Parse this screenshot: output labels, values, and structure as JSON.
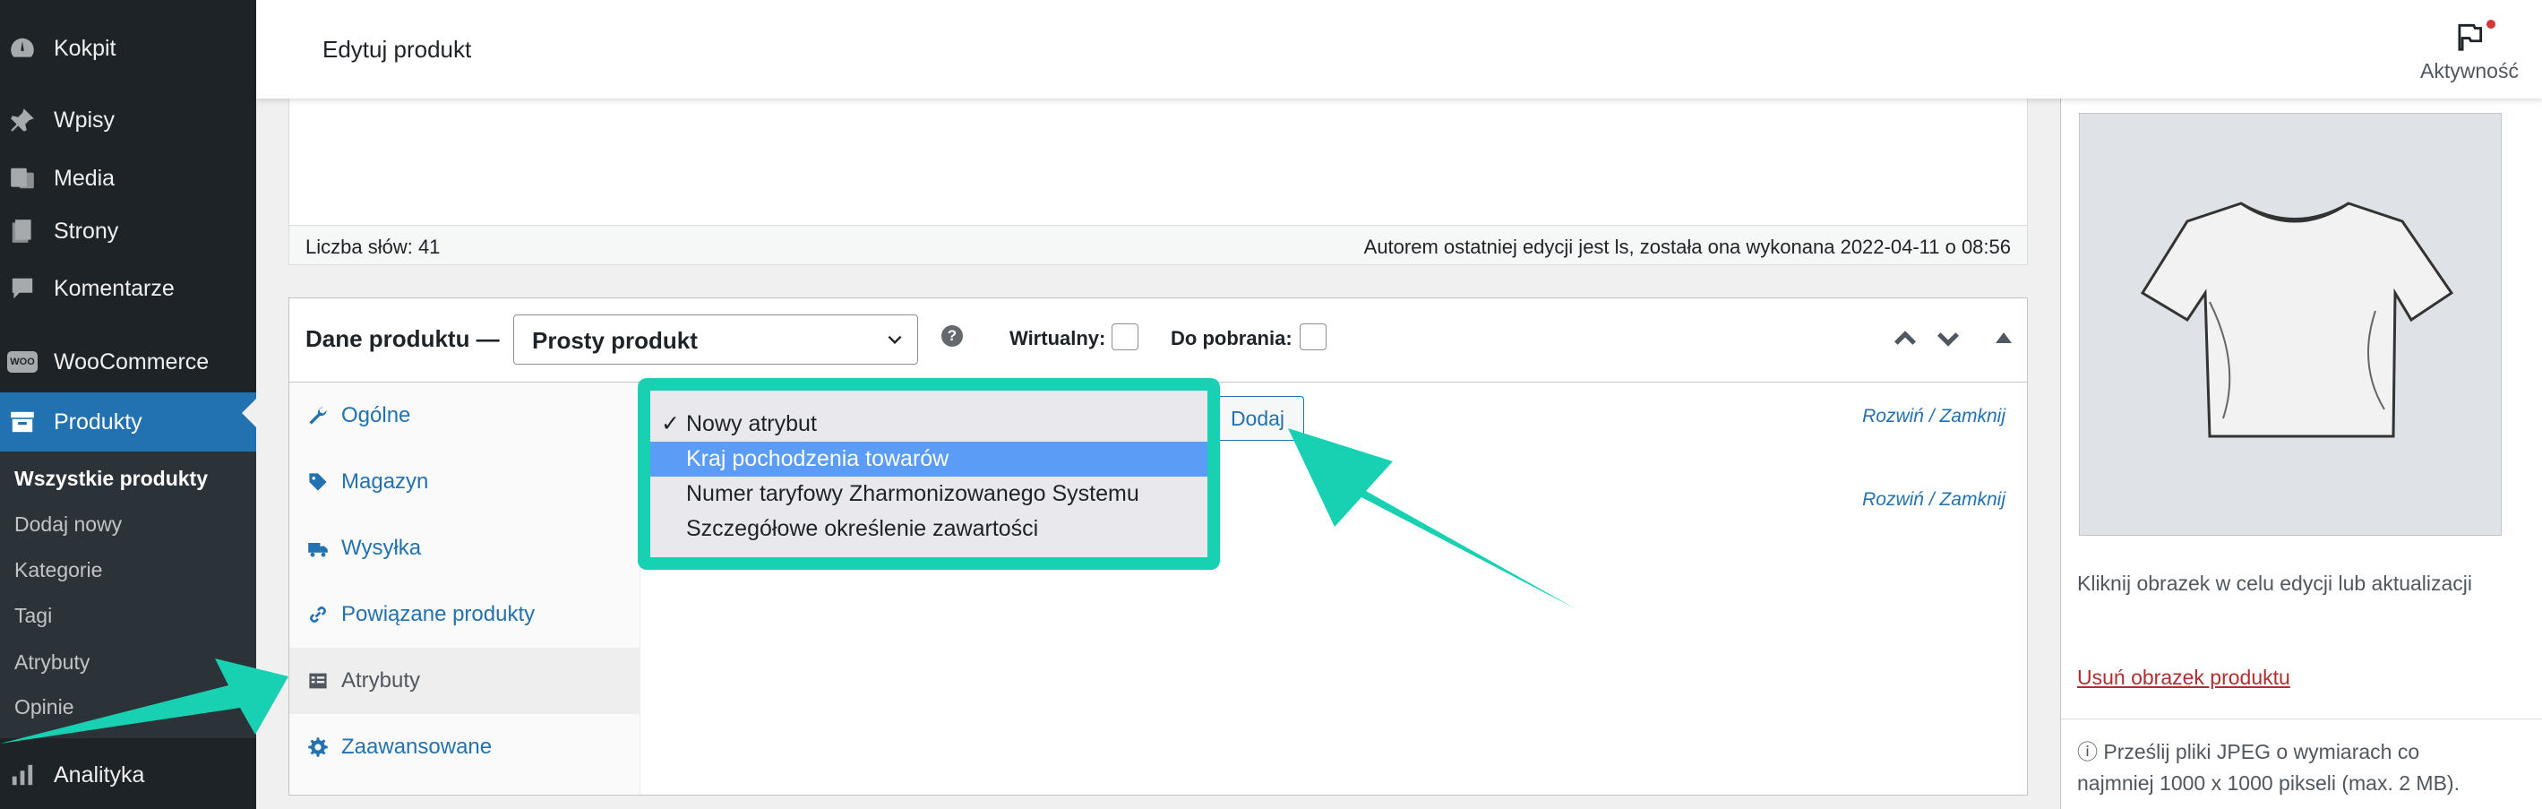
{
  "sidebar": {
    "items": [
      {
        "label": "Kokpit",
        "icon": "dashboard-icon"
      },
      {
        "label": "Wpisy",
        "icon": "pin-icon"
      },
      {
        "label": "Media",
        "icon": "media-icon"
      },
      {
        "label": "Strony",
        "icon": "pages-icon"
      },
      {
        "label": "Komentarze",
        "icon": "comments-icon"
      },
      {
        "label": "WooCommerce",
        "icon": "woocommerce-icon"
      },
      {
        "label": "Produkty",
        "icon": "archive-icon"
      },
      {
        "label": "Analityka",
        "icon": "chart-bar-icon"
      }
    ],
    "submenu": [
      "Wszystkie produkty",
      "Dodaj nowy",
      "Kategorie",
      "Tagi",
      "Atrybuty",
      "Opinie"
    ],
    "woo_badge": "WOO"
  },
  "topbar": {
    "title": "Edytuj produkt",
    "activity_label": "Aktywność"
  },
  "editor": {
    "word_count": "Liczba słów: 41",
    "last_edit": "Autorem ostatniej edycji jest ls, została ona wykonana 2022-04-11 o 08:56"
  },
  "product_data": {
    "title": "Dane produktu —",
    "type_selected": "Prosty produkt",
    "help": "?",
    "virtual_label": "Wirtualny:",
    "download_label": "Do pobrania:",
    "tabs": [
      "Ogólne",
      "Magazyn",
      "Wysyłka",
      "Powiązane produkty",
      "Atrybuty",
      "Zaawansowane"
    ],
    "add_button": "Dodaj",
    "expand_collapse": "Rozwiń / Zamknij"
  },
  "attribute_menu": {
    "check": "✓",
    "options": [
      "Nowy atrybut",
      "Kraj pochodzenia towarów",
      "Numer taryfowy Zharmonizowanego Systemu",
      "Szczegółowe określenie zawartości"
    ]
  },
  "image_box": {
    "hint": "Kliknij obrazek w celu edycji lub aktualizacji",
    "remove_link": "Usuń obrazek produktu",
    "info": "ⓘ Prześlij pliki JPEG o wymiarach co najmniej 1000 x 1000 pikseli (max. 2 MB)."
  },
  "colors": {
    "sidebar_bg": "#1d2327",
    "active_blue": "#2271b1",
    "highlight_teal": "#18d1b2",
    "menu_highlight": "#5b9cf6"
  }
}
